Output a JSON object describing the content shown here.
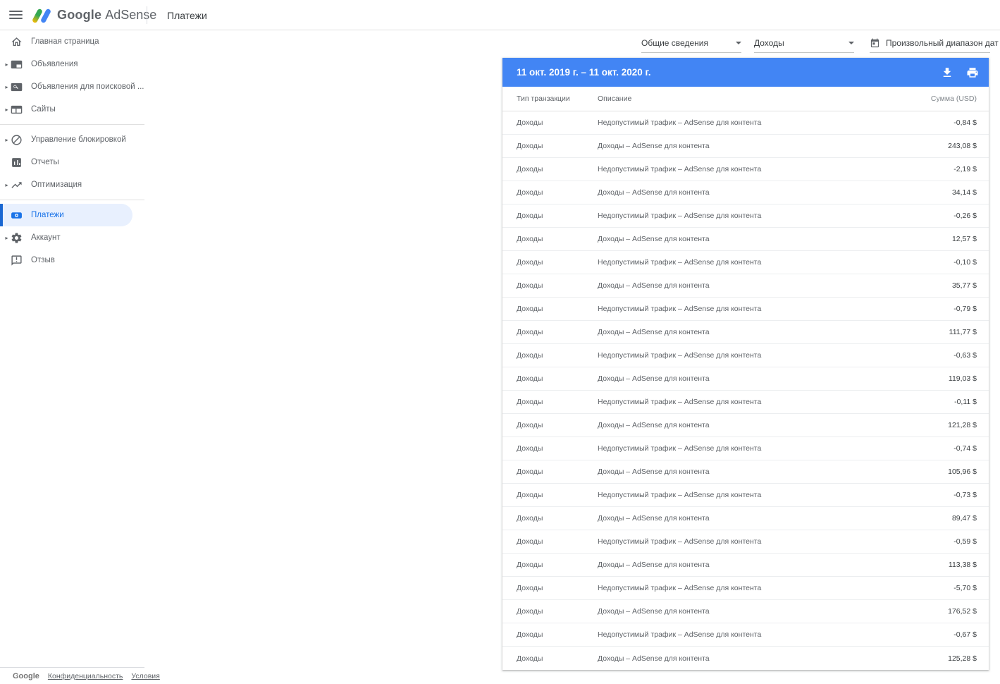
{
  "app": {
    "brand": {
      "google": "Google",
      "product": "AdSense"
    },
    "page_title": "Платежи"
  },
  "filters": {
    "report_select": {
      "value": "Общие сведения"
    },
    "type_select": {
      "value": "Доходы"
    },
    "date_select": {
      "value": "Произвольный диапазон дат",
      "icon": "calendar-icon"
    }
  },
  "sidebar": {
    "items": [
      {
        "id": "home",
        "label": "Главная страница",
        "icon": "home-icon",
        "expandable": false,
        "selected": false,
        "divider_after": false
      },
      {
        "id": "ads",
        "label": "Объявления",
        "icon": "ads-icon",
        "expandable": true,
        "selected": false,
        "divider_after": false
      },
      {
        "id": "search-ads",
        "label": "Объявления для поисковой ...",
        "icon": "search-ads-icon",
        "expandable": true,
        "selected": false,
        "divider_after": false
      },
      {
        "id": "sites",
        "label": "Сайты",
        "icon": "sites-icon",
        "expandable": true,
        "selected": false,
        "divider_after": true
      },
      {
        "id": "blocking",
        "label": "Управление блокировкой",
        "icon": "block-icon",
        "expandable": true,
        "selected": false,
        "divider_after": false
      },
      {
        "id": "reports",
        "label": "Отчеты",
        "icon": "reports-icon",
        "expandable": false,
        "selected": false,
        "divider_after": false
      },
      {
        "id": "optimization",
        "label": "Оптимизация",
        "icon": "optimization-icon",
        "expandable": true,
        "selected": false,
        "divider_after": true
      },
      {
        "id": "payments",
        "label": "Платежи",
        "icon": "payments-icon",
        "expandable": false,
        "selected": true,
        "divider_after": false
      },
      {
        "id": "account",
        "label": "Аккаунт",
        "icon": "account-icon",
        "expandable": true,
        "selected": false,
        "divider_after": false
      },
      {
        "id": "feedback",
        "label": "Отзыв",
        "icon": "feedback-icon",
        "expandable": false,
        "selected": false,
        "divider_after": false
      }
    ]
  },
  "table": {
    "date_range": "11 окт. 2019 г. – 11 окт. 2020 г.",
    "columns": [
      "Тип транзакции",
      "Описание",
      "Сумма (USD)"
    ],
    "accent_color": "#4285f4",
    "rows": [
      {
        "type": "Доходы",
        "description": "Недопустимый трафик – AdSense для контента",
        "amount": "-0,84 $"
      },
      {
        "type": "Доходы",
        "description": "Доходы – AdSense для контента",
        "amount": "243,08 $"
      },
      {
        "type": "Доходы",
        "description": "Недопустимый трафик – AdSense для контента",
        "amount": "-2,19 $"
      },
      {
        "type": "Доходы",
        "description": "Доходы – AdSense для контента",
        "amount": "34,14 $"
      },
      {
        "type": "Доходы",
        "description": "Недопустимый трафик – AdSense для контента",
        "amount": "-0,26 $"
      },
      {
        "type": "Доходы",
        "description": "Доходы – AdSense для контента",
        "amount": "12,57 $"
      },
      {
        "type": "Доходы",
        "description": "Недопустимый трафик – AdSense для контента",
        "amount": "-0,10 $"
      },
      {
        "type": "Доходы",
        "description": "Доходы – AdSense для контента",
        "amount": "35,77 $"
      },
      {
        "type": "Доходы",
        "description": "Недопустимый трафик – AdSense для контента",
        "amount": "-0,79 $"
      },
      {
        "type": "Доходы",
        "description": "Доходы – AdSense для контента",
        "amount": "111,77 $"
      },
      {
        "type": "Доходы",
        "description": "Недопустимый трафик – AdSense для контента",
        "amount": "-0,63 $"
      },
      {
        "type": "Доходы",
        "description": "Доходы – AdSense для контента",
        "amount": "119,03 $"
      },
      {
        "type": "Доходы",
        "description": "Недопустимый трафик – AdSense для контента",
        "amount": "-0,11 $"
      },
      {
        "type": "Доходы",
        "description": "Доходы – AdSense для контента",
        "amount": "121,28 $"
      },
      {
        "type": "Доходы",
        "description": "Недопустимый трафик – AdSense для контента",
        "amount": "-0,74 $"
      },
      {
        "type": "Доходы",
        "description": "Доходы – AdSense для контента",
        "amount": "105,96 $"
      },
      {
        "type": "Доходы",
        "description": "Недопустимый трафик – AdSense для контента",
        "amount": "-0,73 $"
      },
      {
        "type": "Доходы",
        "description": "Доходы – AdSense для контента",
        "amount": "89,47 $"
      },
      {
        "type": "Доходы",
        "description": "Недопустимый трафик – AdSense для контента",
        "amount": "-0,59 $"
      },
      {
        "type": "Доходы",
        "description": "Доходы – AdSense для контента",
        "amount": "113,38 $"
      },
      {
        "type": "Доходы",
        "description": "Недопустимый трафик – AdSense для контента",
        "amount": "-5,70 $"
      },
      {
        "type": "Доходы",
        "description": "Доходы – AdSense для контента",
        "amount": "176,52 $"
      },
      {
        "type": "Доходы",
        "description": "Недопустимый трафик – AdSense для контента",
        "amount": "-0,67 $"
      },
      {
        "type": "Доходы",
        "description": "Доходы – AdSense для контента",
        "amount": "125,28 $"
      }
    ]
  },
  "footer": {
    "brand": "Google",
    "links": [
      {
        "label": "Конфиденциальность"
      },
      {
        "label": "Условия"
      }
    ]
  }
}
